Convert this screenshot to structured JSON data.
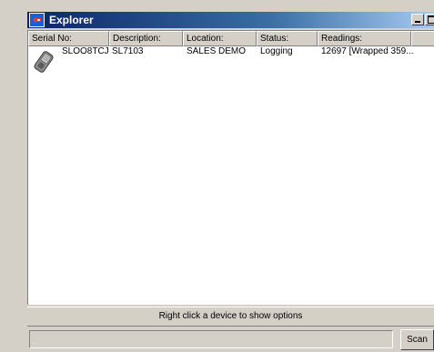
{
  "window": {
    "title": "Explorer"
  },
  "list": {
    "columns": [
      "Serial No:",
      "Description:",
      "Location:",
      "Status:",
      "Readings:"
    ],
    "rows": [
      {
        "serial": "SLOO8TCJ",
        "description": "SL7103",
        "location": "SALES DEMO",
        "status": "Logging",
        "readings": "12697 [Wrapped 359..."
      }
    ]
  },
  "hint": "Right click a device to show options",
  "statusbar": {
    "scan_label": "Scan"
  },
  "colors": {
    "titlebar_start": "#0a246a",
    "titlebar_end": "#a6caf0",
    "chrome": "#d4d0c8"
  }
}
